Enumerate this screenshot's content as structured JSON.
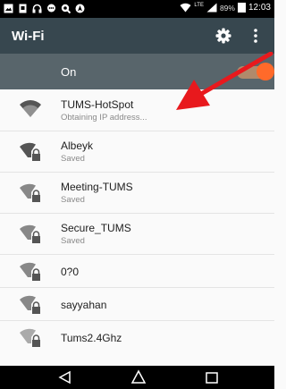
{
  "status_bar": {
    "signal_text": "LTE",
    "battery": "89%",
    "time": "12:03"
  },
  "app_bar": {
    "title": "Wi-Fi",
    "settings_icon": "gear-icon",
    "more_icon": "more-vert-icon"
  },
  "switch": {
    "label": "On",
    "state": "on",
    "accent_color": "#ff6a2a"
  },
  "networks": [
    {
      "name": "TUMS-HotSpot",
      "status": "Obtaining IP address...",
      "secured": false
    },
    {
      "name": "Albeyk",
      "status": "Saved",
      "secured": true
    },
    {
      "name": "Meeting-TUMS",
      "status": "Saved",
      "secured": true
    },
    {
      "name": "Secure_TUMS",
      "status": "Saved",
      "secured": true
    },
    {
      "name": "0?0",
      "status": "",
      "secured": true
    },
    {
      "name": "sayyahan",
      "status": "",
      "secured": true
    },
    {
      "name": "Tums2.4Ghz",
      "status": "",
      "secured": true
    }
  ],
  "annotation": {
    "color": "#e8191d"
  },
  "nav_bar": [
    "back-icon",
    "home-icon",
    "recents-icon"
  ]
}
